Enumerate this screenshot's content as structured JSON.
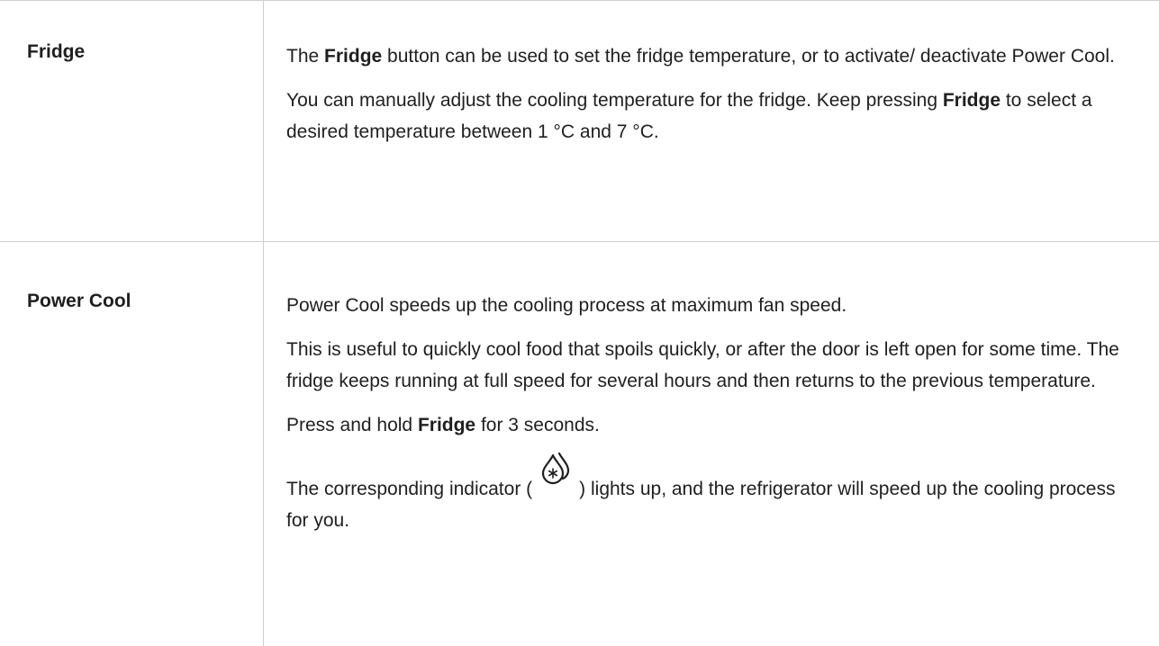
{
  "rows": [
    {
      "label": "Fridge",
      "para1": {
        "t1": "The ",
        "b1": "Fridge",
        "t2": " button can be used to set the fridge temperature, or to activate/ deactivate Power Cool."
      },
      "para2": {
        "t1": "You can manually adjust the cooling temperature for the fridge. Keep pressing ",
        "b1": "Fridge",
        "t2": " to select a desired temperature between 1 °C and 7 °C."
      }
    },
    {
      "label": "Power Cool",
      "para1": "Power Cool speeds up the cooling process at maximum fan speed.",
      "para2": "This is useful to quickly cool food that spoils quickly, or after the door is left open for some time. The fridge keeps running at full speed for several hours and then returns to the previous temperature.",
      "para3": {
        "t1": "Press and hold ",
        "b1": "Fridge",
        "t2": " for 3 seconds."
      },
      "para4": {
        "t1": "The corresponding indicator (",
        "icon": "power-cool-indicator-icon",
        "t2": ") lights up, and the refrigerator will speed up the cooling process for you."
      }
    }
  ]
}
